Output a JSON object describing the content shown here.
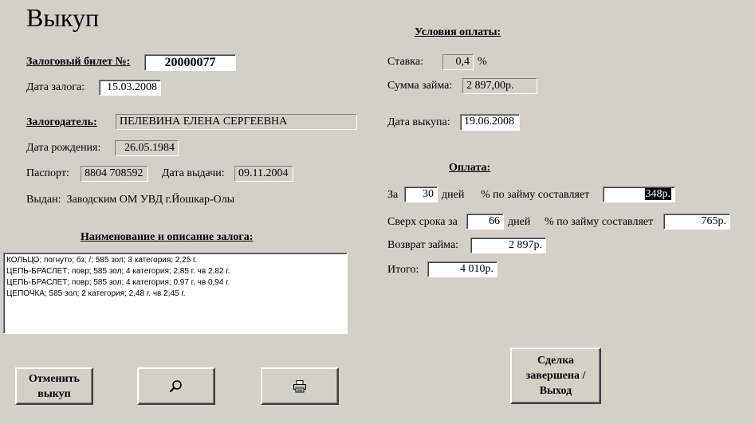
{
  "title": "Выкуп",
  "ticket": {
    "label": "Залоговый билет №:",
    "number": "20000077",
    "date_label": "Дата залога:",
    "date": "15.03.2008"
  },
  "pledger": {
    "label": "Залогодатель:",
    "name": "ПЕЛЕВИНА ЕЛЕНА СЕРГЕЕВНА",
    "birth_label": "Дата рождения:",
    "birth_date": "26.05.1984",
    "passport_label": "Паспорт:",
    "passport": "8804 708592",
    "issue_date_label": "Дата выдачи:",
    "issue_date": "09.11.2004",
    "issued_by": "Выдан:  Заводским ОМ УВД г.Йошкар-Олы"
  },
  "items": {
    "label": "Наименование и описание залога:",
    "lines": [
      "КОЛЬЦО; погнуто; бз; /; 585 зол; 3 категория; 2,25 г.",
      "ЦЕПЬ-БРАСЛЕТ; повр; 585 зол; 4 категория; 2,85 г. чв 2,82 г.",
      "ЦЕПЬ-БРАСЛЕТ; повр; 585 зол; 4 категория; 0,97 г. чв 0,94 г.",
      "ЦЕПОЧКА; 585 зол; 2 категория; 2,48 г. чв 2,45 г."
    ]
  },
  "terms": {
    "label": "Условия оплаты:",
    "rate_label": "Ставка:",
    "rate": "0,4",
    "rate_unit": "%",
    "loan_label": "Сумма займа:",
    "loan": "2 897,00р.",
    "redeem_label": "Дата выкупа:",
    "redeem_date": "19.06.2008"
  },
  "payment": {
    "label": "Оплата:",
    "for_label": "За",
    "days": "30",
    "days_label": "дней",
    "interest_label": "% по займу составляет",
    "interest": "348р.",
    "overdue_label": "Сверх срока за",
    "overdue_days": "66",
    "overdue_days_label": "дней",
    "overdue_interest_label": "% по займу составляет",
    "overdue_interest": "765р.",
    "return_label": "Возврат займа:",
    "return": "2 897р.",
    "total_label": "Итого:",
    "total": "4 010р."
  },
  "buttons": {
    "cancel": "Отменить выкуп",
    "search_icon": "magnifier-icon",
    "print_icon": "printer-icon",
    "finish": "Сделка завершена / Выход"
  }
}
